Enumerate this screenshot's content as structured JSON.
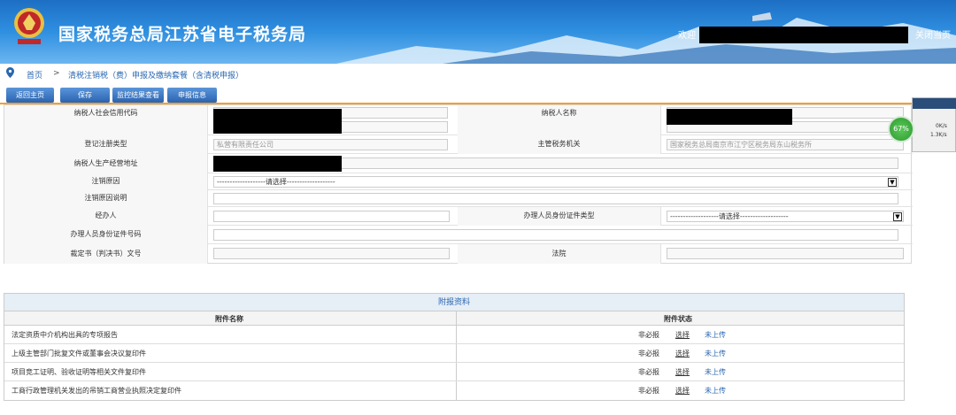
{
  "header": {
    "site_title": "国家税务总局江苏省电子税务局",
    "welcome": "欢迎",
    "close_page": "关闭当页"
  },
  "breadcrumb": {
    "home": "首页",
    "sep": ">",
    "current": "清税注销税（费）申报及缴纳套餐（含清税申报）"
  },
  "toolbar": {
    "back": "返回主页",
    "save": "保存",
    "monitor": "监控结果查看",
    "declare": "申报信息"
  },
  "form": {
    "credit_code_label": "纳税人社会信用代码",
    "taxpayer_name_label": "纳税人名称",
    "reg_type_label": "登记注册类型",
    "reg_type_value": "私营有限责任公司",
    "tax_authority_label": "主管税务机关",
    "tax_authority_value": "国家税务总局南京市江宁区税务局东山税务所",
    "address_label": "纳税人生产经营地址",
    "cancel_reason_label": "注销原因",
    "cancel_reason_value": "-------------------请选择-------------------",
    "cancel_desc_label": "注销原因说明",
    "handler_label": "经办人",
    "handler_id_type_label": "办理人员身份证件类型",
    "handler_id_type_value": "-------------------请选择-------------------",
    "handler_id_no_label": "办理人员身份证件号码",
    "judgment_label": "裁定书（判决书）文号",
    "court_label": "法院"
  },
  "attachments": {
    "title": "附报资料",
    "col_name": "附件名称",
    "col_status": "附件状态",
    "rows": [
      {
        "name": "法定资质中介机构出具的专项报告",
        "req": "非必报",
        "choose": "选择",
        "status": "未上传"
      },
      {
        "name": "上级主管部门批复文件或董事会决议复印件",
        "req": "非必报",
        "choose": "选择",
        "status": "未上传"
      },
      {
        "name": "项目竞工证明、验收证明等相关文件复印件",
        "req": "非必报",
        "choose": "选择",
        "status": "未上传"
      },
      {
        "name": "工商行政管理机关发出的吊销工商营业执照决定复印件",
        "req": "非必报",
        "choose": "选择",
        "status": "未上传"
      }
    ]
  },
  "widget": {
    "percent": "67%",
    "up": "0K/s",
    "down": "1.3K/s"
  }
}
